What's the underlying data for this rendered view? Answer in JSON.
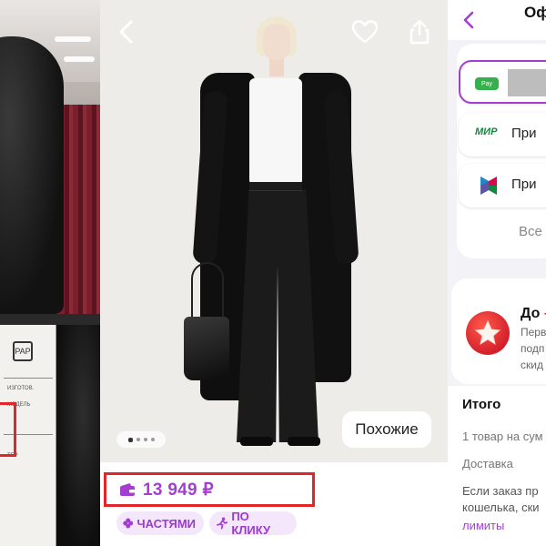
{
  "colors": {
    "accent_purple": "#a43ed1",
    "highlight_red": "#e0262b",
    "chip_background": "#f4e6fb"
  },
  "left_panel": {
    "label_icon_text": "PAP",
    "label_text_lines": [
      "ИЗГОТОВ.",
      "",
      "МОДЕЛЬ",
      "",
      "",
      "ТЕР"
    ]
  },
  "product": {
    "nav": {
      "back_icon": "chevron-left-icon",
      "favorite_icon": "heart-icon",
      "share_icon": "share-icon"
    },
    "gallery": {
      "total_images": 4,
      "active_index": 0
    },
    "similar_label": "Похожие",
    "price": "13 949 ₽",
    "price_icon": "wallet-icon",
    "chips": [
      {
        "label": "ЧАСТЯМИ",
        "icon": "parts-icon"
      },
      {
        "label": "ПО КЛИКУ",
        "icon": "running-icon"
      }
    ]
  },
  "checkout": {
    "title": "Оф",
    "payment_options": [
      {
        "badge": "Pay",
        "label": ""
      },
      {
        "logo": "МИР",
        "label": "При"
      },
      {
        "logo": "sbp-icon",
        "label": "При"
      }
    ],
    "all_methods": "Все",
    "promo": {
      "title_prefix": "До",
      "title_accent": " –",
      "lines": [
        "Перв",
        "подп",
        "скид"
      ]
    },
    "summary": {
      "title": "Итого",
      "items_line": "1 товар на сум",
      "delivery": "Доставка",
      "note_line1": "Если заказ пр",
      "note_line2": "кошелька, ски",
      "link": "лимиты"
    }
  }
}
